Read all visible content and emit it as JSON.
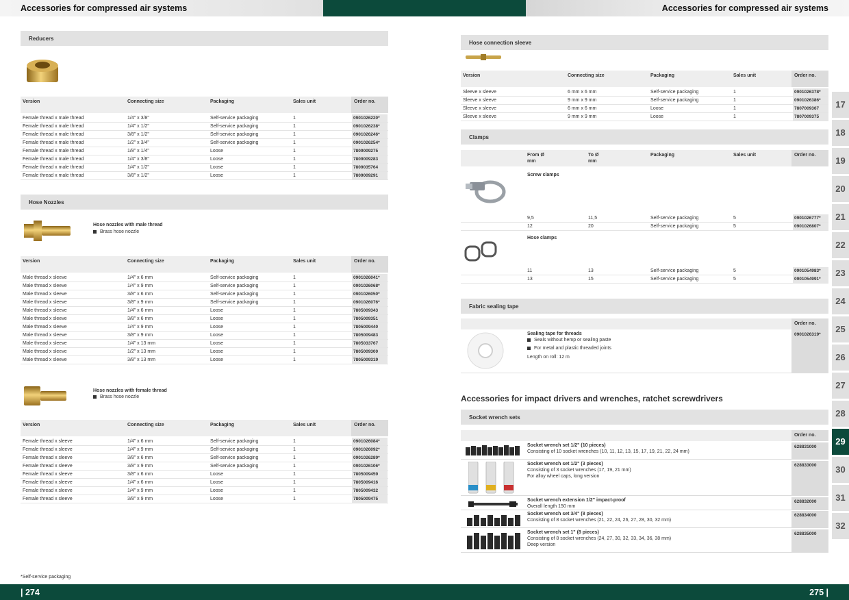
{
  "header": {
    "left_title": "Accessories for compressed air systems",
    "right_title": "Accessories for compressed air systems"
  },
  "footer": {
    "left_page": "| 274",
    "right_page": "275 |",
    "footnote": "*Self-service packaging"
  },
  "colors": {
    "brand_green": "#0c4a3b",
    "section_grey": "#e2e2e2",
    "order_grey": "#e6e6e6"
  },
  "columns": {
    "version": "Version",
    "connecting_size": "Connecting size",
    "packaging": "Packaging",
    "sales_unit": "Sales unit",
    "order_no": "Order no.",
    "from": "From Ø",
    "to": "To Ø",
    "mm": "mm"
  },
  "reducers": {
    "title": "Reducers",
    "rows": [
      [
        "Female thread x male thread",
        "1/4\" x 3/8\"",
        "Self-service packaging",
        "1",
        "0901026220*"
      ],
      [
        "Female thread x male thread",
        "1/4\" x 1/2\"",
        "Self-service packaging",
        "1",
        "0901026238*"
      ],
      [
        "Female thread x male thread",
        "3/8\" x 1/2\"",
        "Self-service packaging",
        "1",
        "0901026246*"
      ],
      [
        "Female thread x male thread",
        "1/2\" x 3/4\"",
        "Self-service packaging",
        "1",
        "0901026254*"
      ],
      [
        "Female thread x male thread",
        "1/8\" x 1/4\"",
        "Loose",
        "1",
        "7809009275"
      ],
      [
        "Female thread x male thread",
        "1/4\" x 3/8\"",
        "Loose",
        "1",
        "7809009283"
      ],
      [
        "Female thread x male thread",
        "1/4\" x 1/2\"",
        "Loose",
        "1",
        "7809035764"
      ],
      [
        "Female thread x male thread",
        "3/8\" x 1/2\"",
        "Loose",
        "1",
        "7809009291"
      ]
    ]
  },
  "hose_nozzles": {
    "title": "Hose Nozzles",
    "male": {
      "heading": "Hose nozzles with male thread",
      "bullet": "Brass hose nozzle",
      "rows": [
        [
          "Male thread x sleeve",
          "1/4\" x 6 mm",
          "Self-service packaging",
          "1",
          "0901026041*"
        ],
        [
          "Male thread x sleeve",
          "1/4\" x 9 mm",
          "Self-service packaging",
          "1",
          "0901026068*"
        ],
        [
          "Male thread x sleeve",
          "3/8\" x 6 mm",
          "Self-service packaging",
          "1",
          "0901026050*"
        ],
        [
          "Male thread x sleeve",
          "3/8\" x 9 mm",
          "Self-service packaging",
          "1",
          "0901026076*"
        ],
        [
          "Male thread x sleeve",
          "1/4\" x 6 mm",
          "Loose",
          "1",
          "7805009343"
        ],
        [
          "Male thread x sleeve",
          "3/8\" x 6 mm",
          "Loose",
          "1",
          "7805009351"
        ],
        [
          "Male thread x sleeve",
          "1/4\" x 9 mm",
          "Loose",
          "1",
          "7805009440"
        ],
        [
          "Male thread x sleeve",
          "3/8\" x 9 mm",
          "Loose",
          "1",
          "7805009483"
        ],
        [
          "Male thread x sleeve",
          "1/4\" x 13 mm",
          "Loose",
          "1",
          "7805033767"
        ],
        [
          "Male thread x sleeve",
          "1/2\" x 13 mm",
          "Loose",
          "1",
          "7805009300"
        ],
        [
          "Male thread x sleeve",
          "3/8\" x 13 mm",
          "Loose",
          "1",
          "7805009319"
        ]
      ]
    },
    "female": {
      "heading": "Hose nozzles with female thread",
      "bullet": "Brass hose nozzle",
      "rows": [
        [
          "Female thread x sleeve",
          "1/4\" x 6 mm",
          "Self-service packaging",
          "1",
          "0901026084*"
        ],
        [
          "Female thread x sleeve",
          "1/4\" x 9 mm",
          "Self-service packaging",
          "1",
          "0901026092*"
        ],
        [
          "Female thread x sleeve",
          "3/8\" x 6 mm",
          "Self-service packaging",
          "1",
          "0901026289*"
        ],
        [
          "Female thread x sleeve",
          "3/8\" x 9 mm",
          "Self-service packaging",
          "1",
          "0901026106*"
        ],
        [
          "Female thread x sleeve",
          "3/8\" x 6 mm",
          "Loose",
          "1",
          "7805009459"
        ],
        [
          "Female thread x sleeve",
          "1/4\" x 6 mm",
          "Loose",
          "1",
          "7805009416"
        ],
        [
          "Female thread x sleeve",
          "1/4\" x 9 mm",
          "Loose",
          "1",
          "7805009432"
        ],
        [
          "Female thread x sleeve",
          "3/8\" x 9 mm",
          "Loose",
          "1",
          "7805009475"
        ]
      ]
    }
  },
  "hose_connection_sleeve": {
    "title": "Hose connection sleeve",
    "rows": [
      [
        "Sleeve x sleeve",
        "6 mm x 6 mm",
        "Self-service packaging",
        "1",
        "0901026378*"
      ],
      [
        "Sleeve x sleeve",
        "9 mm x 9 mm",
        "Self-service packaging",
        "1",
        "0901026386*"
      ],
      [
        "Sleeve x sleeve",
        "6 mm x 6 mm",
        "Loose",
        "1",
        "7807009367"
      ],
      [
        "Sleeve x sleeve",
        "9 mm x 9 mm",
        "Loose",
        "1",
        "7807009375"
      ]
    ]
  },
  "clamps": {
    "title": "Clamps",
    "screw": {
      "heading": "Screw clamps",
      "rows": [
        [
          "9,5",
          "11,5",
          "Self-service packaging",
          "5",
          "0901026777*"
        ],
        [
          "12",
          "20",
          "Self-service packaging",
          "5",
          "0901026807*"
        ]
      ]
    },
    "hose": {
      "heading": "Hose clamps",
      "rows": [
        [
          "11",
          "13",
          "Self-service packaging",
          "5",
          "0901054983*"
        ],
        [
          "13",
          "15",
          "Self-service packaging",
          "5",
          "0901054991*"
        ]
      ]
    }
  },
  "fabric_tape": {
    "title": "Fabric sealing tape",
    "heading": "Sealing tape for threads",
    "bullets": [
      "Seals without hemp or sealing paste",
      "For metal and plastic threaded joints"
    ],
    "length": "Length on roll: 12 m",
    "order": "0901026319*"
  },
  "impact": {
    "heading": "Accessories for impact drivers and wrenches, ratchet screwdrivers",
    "section": "Socket wrench sets",
    "items": [
      {
        "title": "Socket wrench set 1/2\" (10 pieces)",
        "lines": [
          "Consisting of 10 socket wrenches (10, 11, 12, 13, 15, 17, 19, 21, 22, 24 mm)"
        ],
        "order": "628831000"
      },
      {
        "title": "Socket wrench set 1/2\" (3 pieces)",
        "lines": [
          "Consisting of 3 socket wrenches (17, 19, 21 mm)",
          "For alloy wheel caps, long version"
        ],
        "order": "628833000"
      },
      {
        "title": "Socket wrench extension 1/2\" impact-proof",
        "lines": [
          "Overall length 150 mm"
        ],
        "order": "628832000"
      },
      {
        "title": "Socket wrench set 3/4\" (8 pieces)",
        "lines": [
          "Consisting of 8 socket wrenches (21, 22, 24, 26, 27, 28, 30, 32 mm)"
        ],
        "order": "628834000"
      },
      {
        "title": "Socket wrench set 1\" (8 pieces)",
        "lines": [
          "Consisting of 8 socket wrenches (24, 27, 30, 32, 33, 34, 36, 38 mm)",
          "Deep version"
        ],
        "order": "628835000"
      }
    ]
  },
  "side_tabs": [
    "17",
    "18",
    "19",
    "20",
    "21",
    "22",
    "23",
    "24",
    "25",
    "26",
    "27",
    "28",
    "29",
    "30",
    "31",
    "32"
  ],
  "active_tab": "29"
}
